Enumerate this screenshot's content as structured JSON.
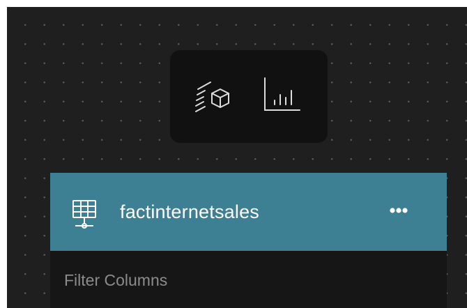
{
  "toolbar": {
    "buttons": [
      {
        "icon": "3d-model-cube-icon"
      },
      {
        "icon": "bar-chart-icon"
      }
    ]
  },
  "node": {
    "icon": "database-table-icon",
    "title": "factinternetsales",
    "menu_icon": "more-options-icon",
    "filter": {
      "placeholder": "Filter Columns",
      "value": ""
    }
  },
  "colors": {
    "canvas_background": "#1f1f1f",
    "dot_grid": "#5a5a5a",
    "toolbar_background": "#111111",
    "node_header": "#3d7f93",
    "node_body": "#161616"
  }
}
